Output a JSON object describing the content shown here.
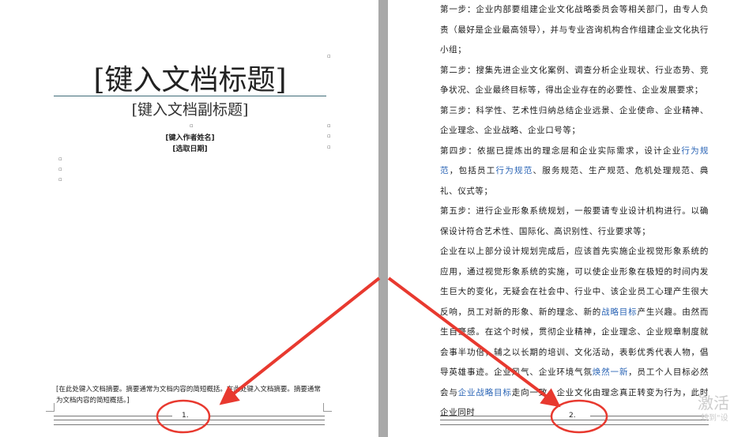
{
  "page1": {
    "title": "[键入文档标题]",
    "subtitle": "[键入文档副标题]",
    "author": "[键入作者姓名]",
    "date": "[选取日期]",
    "abstract": "[在此处键入文档摘要。摘要通常为文档内容的简短概括。在此处键入文档摘要。摘要通常为文档内容的简短概括。]",
    "page_number": "1."
  },
  "page2": {
    "paragraphs": [
      [
        {
          "t": "第一步：企业内部要组建企业文化战略委员会等相关部门，由专人负责（最好是企业最高领导），并与专业咨询机构合作组建企业文化执行小组；"
        }
      ],
      [
        {
          "t": "第二步：搜集先进企业文化案例、调查分析企业现状、行业态势、竞争状况、企业最终目标等，得出企业存在的必要性、企业发展要求；"
        }
      ],
      [
        {
          "t": "第三步：科学性、艺术性归纳总结企业远景、企业使命、企业精神、企业理念、企业战略、企业口号等；"
        }
      ],
      [
        {
          "t": "第四步：依据已提炼出的理念层和企业实际需求，设计企业"
        },
        {
          "t": "行为规范",
          "hl": true
        },
        {
          "t": "，包括员工"
        },
        {
          "t": "行为规范",
          "hl": true
        },
        {
          "t": "、服务规范、生产规范、危机处理规范、典礼、仪式等；"
        }
      ],
      [
        {
          "t": "第五步：进行企业形象系统规划，一般要请专业设计机构进行。以确保设计符合艺术性、国际化、高识别性、行业要求等；"
        }
      ],
      [
        {
          "t": "企业在以上部分设计规划完成后，应该首先实施企业视觉形象系统的应用，通过视觉形象系统的实施，可以使企业形象在极短的时间内发生巨大的变化，无疑会在社会中、行业中、该企业员工心理产生很大反响，员工对新的形象、新的理念、新的"
        },
        {
          "t": "战略目标",
          "hl": true
        },
        {
          "t": "产生兴趣。由然而生自豪感。在这个时候，贯彻企业精神，企业理念、企业规章制度就会事半功倍，辅之以长期的培训、文化活动，表彰优秀代表人物，倡导英雄事迹。企业风气、企业环境气氛"
        },
        {
          "t": "焕然一新",
          "hl": true
        },
        {
          "t": "，员工个人目标必然会与"
        },
        {
          "t": "企业战略目标",
          "hl": true
        },
        {
          "t": "走向一致，企业文化由理念真正转变为行为，此时企业同时"
        }
      ]
    ],
    "page_number": "2."
  },
  "watermark": {
    "text1": "激活",
    "text2": "转到\"设"
  },
  "colors": {
    "arrow": "#e8392f",
    "circle": "#e8392f",
    "link": "#2a64b5"
  }
}
